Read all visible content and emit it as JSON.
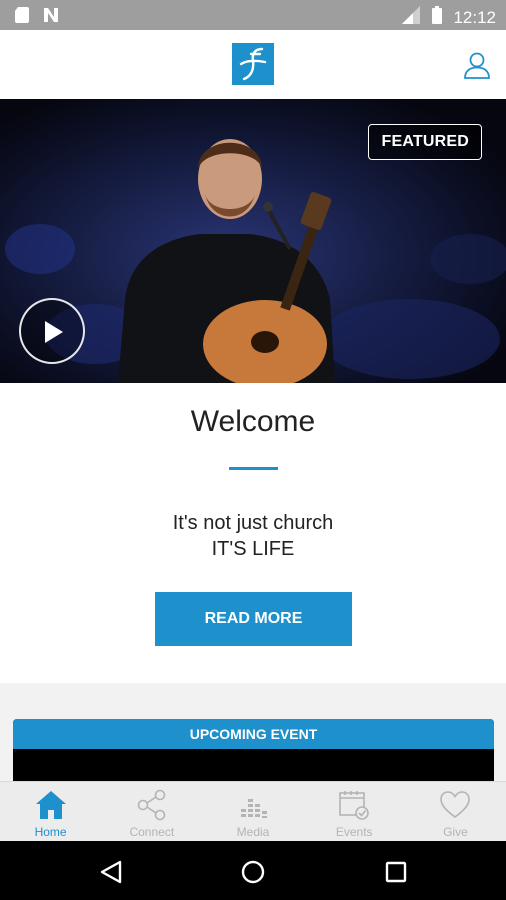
{
  "status_bar": {
    "time": "12:12",
    "icons": [
      "sd-card-icon",
      "notification-n-icon",
      "signal-icon",
      "battery-icon"
    ]
  },
  "header": {
    "logo": "church-logo",
    "profile_icon": "user-profile-icon",
    "accent_color": "#1e91cc"
  },
  "hero": {
    "badge": "FEATURED",
    "play_icon": "play-icon"
  },
  "welcome": {
    "title": "Welcome",
    "tagline_line1": "It's not just church",
    "tagline_line2": "IT'S LIFE",
    "button_label": "READ MORE"
  },
  "event": {
    "header": "UPCOMING EVENT"
  },
  "tabs": [
    {
      "label": "Home",
      "icon": "home-icon",
      "active": true
    },
    {
      "label": "Connect",
      "icon": "share-icon",
      "active": false
    },
    {
      "label": "Media",
      "icon": "equalizer-icon",
      "active": false
    },
    {
      "label": "Events",
      "icon": "calendar-check-icon",
      "active": false
    },
    {
      "label": "Give",
      "icon": "heart-icon",
      "active": false
    }
  ],
  "nav_bar": {
    "icons": [
      "back-icon",
      "home-circle-icon",
      "recents-icon"
    ]
  }
}
